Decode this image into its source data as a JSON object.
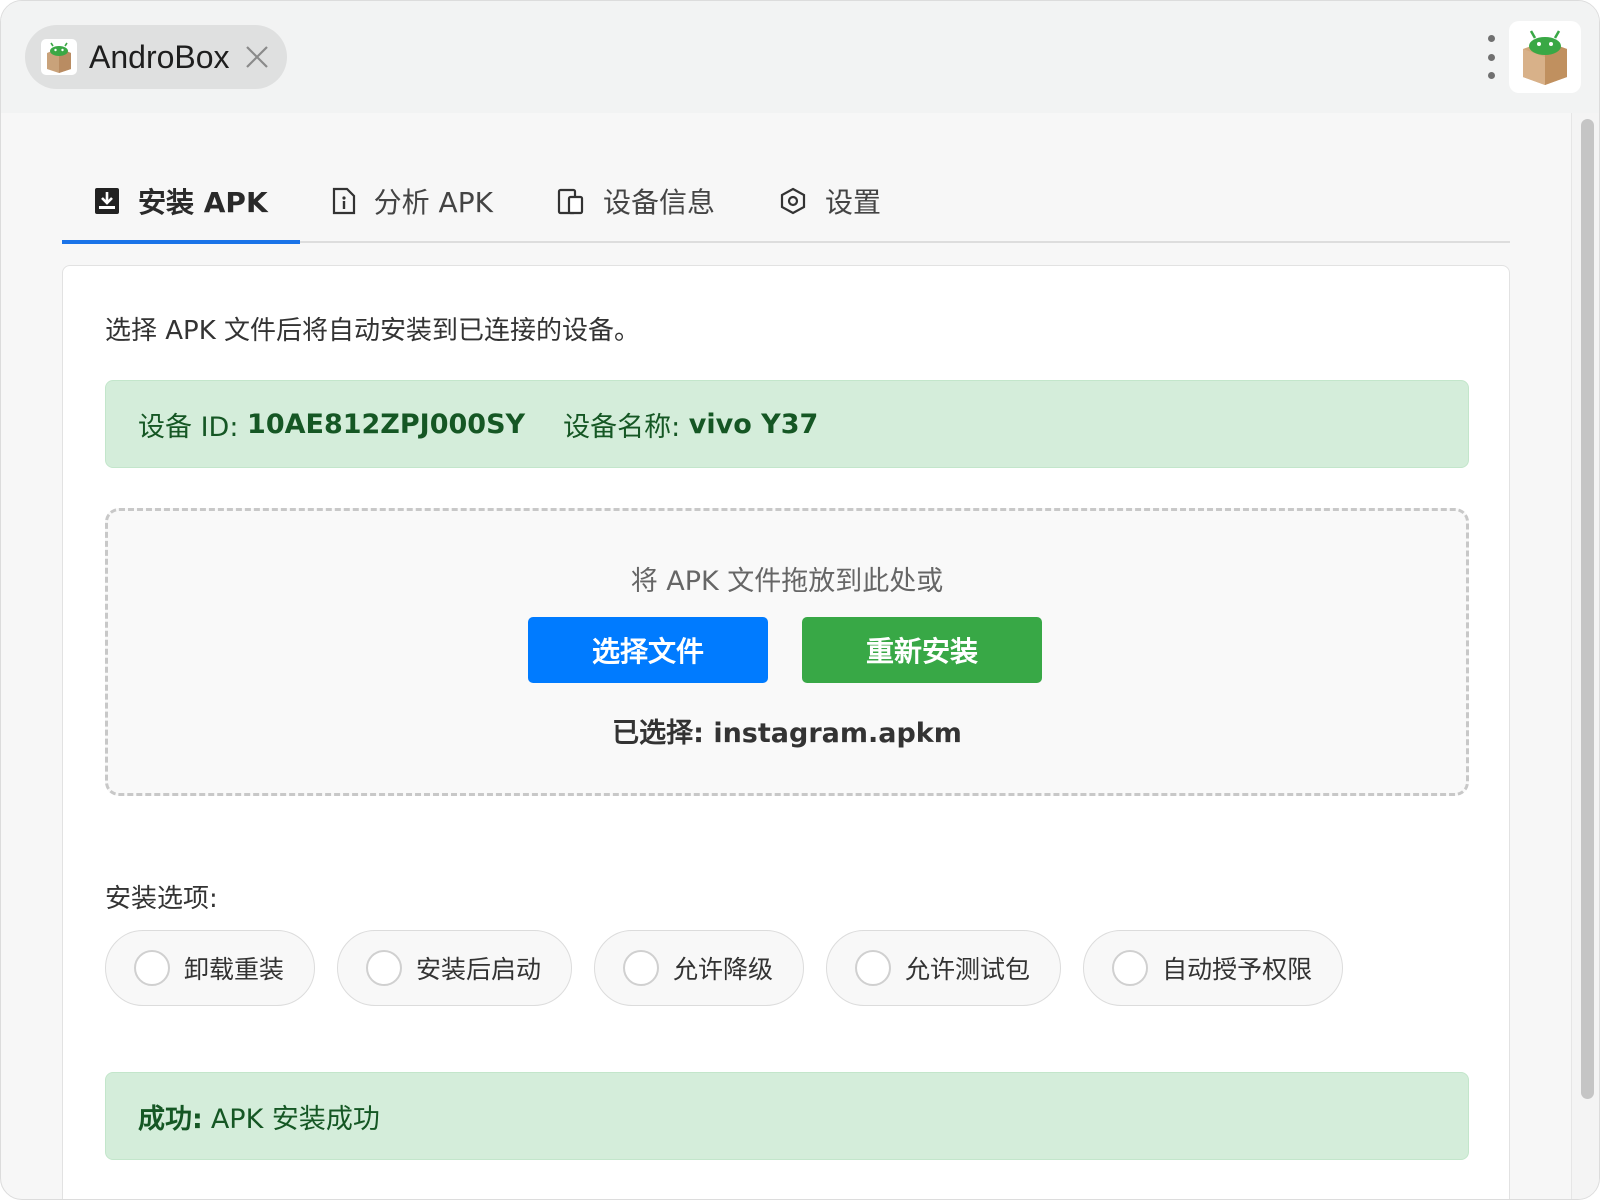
{
  "window": {
    "tab_title": "AndroBox"
  },
  "tabs": [
    {
      "label": "安装 APK",
      "icon": "install-icon",
      "active": true
    },
    {
      "label": "分析 APK",
      "icon": "info-file-icon",
      "active": false
    },
    {
      "label": "设备信息",
      "icon": "devices-icon",
      "active": false
    },
    {
      "label": "设置",
      "icon": "settings-hex-icon",
      "active": false
    }
  ],
  "install": {
    "intro": "选择 APK 文件后将自动安装到已连接的设备。",
    "device": {
      "id_label": "设备 ID:",
      "id_value": "10AE812ZPJ000SY",
      "name_label": "设备名称:",
      "name_value": "vivo Y37"
    },
    "dropzone": {
      "text": "将 APK 文件拖放到此处或",
      "choose_button": "选择文件",
      "reinstall_button": "重新安装",
      "selected_label": "已选择:",
      "selected_file": "instagram.apkm"
    },
    "options_label": "安装选项:",
    "options": [
      {
        "label": "卸载重装",
        "checked": false
      },
      {
        "label": "安装后启动",
        "checked": false
      },
      {
        "label": "允许降级",
        "checked": false
      },
      {
        "label": "允许测试包",
        "checked": false
      },
      {
        "label": "自动授予权限",
        "checked": false
      }
    ],
    "status": {
      "label": "成功:",
      "message": "APK 安装成功"
    }
  },
  "colors": {
    "primary": "#007bff",
    "success": "#38a846",
    "success_bg": "#d4edda",
    "success_text": "#155724",
    "active_tab": "#1a73e8"
  }
}
